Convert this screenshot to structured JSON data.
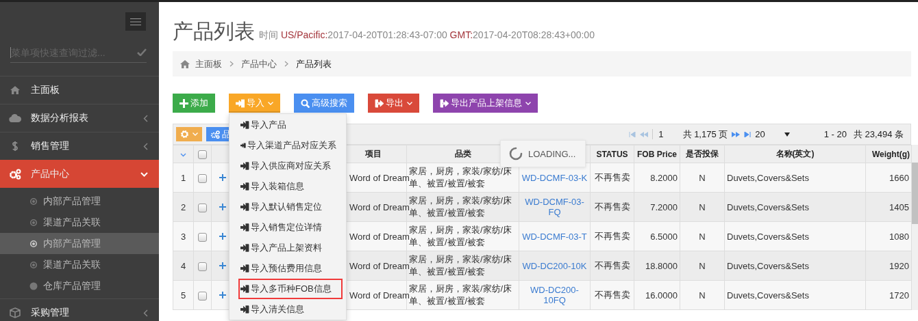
{
  "sidebar": {
    "filter_placeholder": "菜单项快速查询过滤...",
    "items": [
      {
        "label": "主面板",
        "selected": false
      },
      {
        "label": "数据分析报表",
        "expanded": false,
        "selected": false
      },
      {
        "label": "销售管理",
        "expanded": false,
        "selected": false
      },
      {
        "label": "产品中心",
        "expanded": true,
        "selected": true,
        "children": [
          {
            "label": "内部产品管理",
            "kind": "ring",
            "selected": false
          },
          {
            "label": "渠道产品关联",
            "kind": "ring",
            "selected": false
          },
          {
            "label": "内部产品管理",
            "kind": "ring",
            "selected": true
          },
          {
            "label": "渠道产品关联",
            "kind": "ring",
            "selected": false
          },
          {
            "label": "仓库产品管理",
            "kind": "dot",
            "selected": false
          }
        ]
      },
      {
        "label": "采购管理",
        "expanded": false,
        "selected": false
      }
    ]
  },
  "page": {
    "title": "产品列表",
    "time_label": "时间",
    "zones": [
      {
        "name": "US/Pacific:",
        "value": "2017-04-20T01:28:43-07:00"
      },
      {
        "name": "GMT:",
        "value": "2017-04-20T08:28:43+00:00"
      }
    ]
  },
  "breadcrumb": [
    "主面板",
    "产品中心",
    "产品列表"
  ],
  "buttons": [
    {
      "label": "添加",
      "kind": "add",
      "color": "#3cab4a",
      "has_menu": false
    },
    {
      "label": "导入",
      "kind": "import",
      "color": "#f9a727",
      "has_menu": true,
      "expanded": true
    },
    {
      "label": "高级搜索",
      "kind": "search",
      "color": "#4a8ff0",
      "has_menu": false
    },
    {
      "label": "导出",
      "kind": "export",
      "color": "#d9493a",
      "has_menu": true
    },
    {
      "label": "导出产品上架信息",
      "kind": "export",
      "color": "#8e44ad",
      "has_menu": true
    }
  ],
  "import_menu": [
    {
      "label": "导入产品",
      "highlighted": false
    },
    {
      "label": "导入渠道产品对应关系",
      "highlighted": false
    },
    {
      "label": "导入供应商对应关系",
      "highlighted": false
    },
    {
      "label": "导入装箱信息",
      "highlighted": false
    },
    {
      "label": "导入默认销售定位",
      "highlighted": false
    },
    {
      "label": "导入销售定位详情",
      "highlighted": false
    },
    {
      "label": "导入产品上架资料",
      "highlighted": false
    },
    {
      "label": "导入预估费用信息",
      "highlighted": false
    },
    {
      "label": "导入多币种FOB信息",
      "highlighted": true
    },
    {
      "label": "导入清关信息",
      "highlighted": false
    }
  ],
  "table_toolbar": {
    "category_button": "品"
  },
  "pager": {
    "page": "1",
    "pages": "共 1,175 页",
    "page_size": "20",
    "range": "1 - 20",
    "total": "共 23,494 条"
  },
  "loading": "LOADING...",
  "table": {
    "all_checked": false,
    "columns": [
      {
        "label": "项目",
        "kind": "text"
      },
      {
        "label": "品类",
        "kind": "wrap"
      },
      {
        "kind": "link"
      },
      {
        "label": "STATUS",
        "kind": "center"
      },
      {
        "label": "FOB Price",
        "kind": "num"
      },
      {
        "label": "是否投保",
        "kind": "center"
      },
      {
        "label": "名称(英文)",
        "kind": "text"
      },
      {
        "label": "Weight(g)",
        "kind": "num"
      }
    ],
    "rows": [
      {
        "index": "1",
        "checked": false,
        "cells": [
          "Word of Dream",
          "家居，厨房，家装/家纺/床单、被置/被置/被套",
          "WD-DCMF-03-K",
          "不再售卖",
          "8.2000",
          "N",
          "Duvets,Covers&Sets",
          "1660"
        ]
      },
      {
        "index": "2",
        "checked": false,
        "cells": [
          "Word of Dream",
          "家居，厨房，家装/家纺/床单、被置/被置/被套",
          "WD-DCMF-03-FQ",
          "不再售卖",
          "7.2000",
          "N",
          "Duvets,Covers&Sets",
          "1405"
        ]
      },
      {
        "index": "3",
        "checked": false,
        "cells": [
          "Word of Dream",
          "家居，厨房，家装/家纺/床单、被置/被置/被套",
          "WD-DCMF-03-T",
          "不再售卖",
          "6.5000",
          "N",
          "Duvets,Covers&Sets",
          "1080"
        ]
      },
      {
        "index": "4",
        "checked": false,
        "cells": [
          "Word of Dream",
          "家居，厨房，家装/家纺/床单、被置/被置/被套",
          "WD-DC200-10K",
          "不再售卖",
          "18.8000",
          "N",
          "Duvets,Covers&Sets",
          "1920"
        ]
      },
      {
        "index": "5",
        "checked": false,
        "cells": [
          "Word of Dream",
          "家居，厨房，家装/家纺/床单、被置/被置/被套",
          "WD-DC200-10FQ",
          "不再售卖",
          "16.0000",
          "N",
          "Duvets,Covers&Sets",
          "1720"
        ]
      }
    ]
  }
}
